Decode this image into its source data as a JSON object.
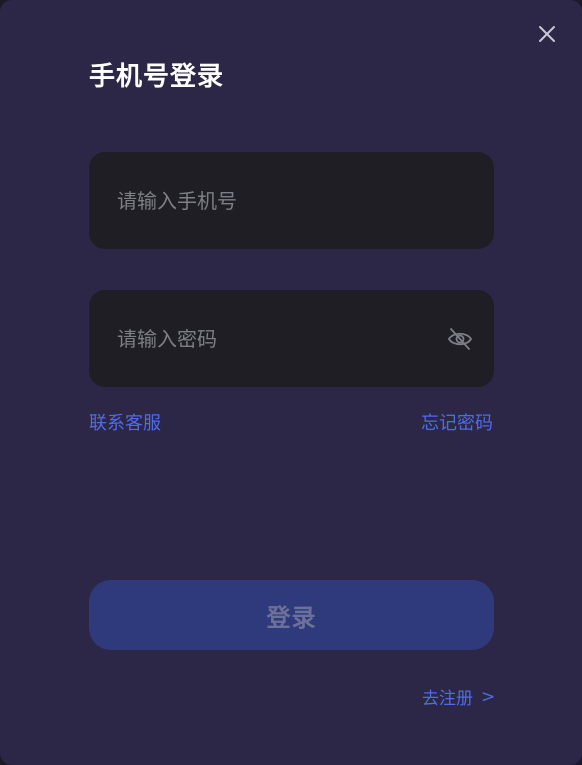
{
  "dialog": {
    "title": "手机号登录"
  },
  "phone_field": {
    "placeholder": "请输入手机号",
    "value": ""
  },
  "password_field": {
    "placeholder": "请输入密码",
    "value": ""
  },
  "links": {
    "contact_support": "联系客服",
    "forgot_password": "忘记密码"
  },
  "login_button": {
    "label": "登录"
  },
  "register_link": {
    "label": "去注册",
    "arrow": ">"
  },
  "icons": {
    "close": "close-icon",
    "password_visibility": "eye-off-icon"
  },
  "colors": {
    "dialog_bg": "#2c2747",
    "input_bg": "#1e1e24",
    "link": "#4f6ce8",
    "button_bg": "#2e3a7c",
    "button_text": "#6d7199"
  }
}
